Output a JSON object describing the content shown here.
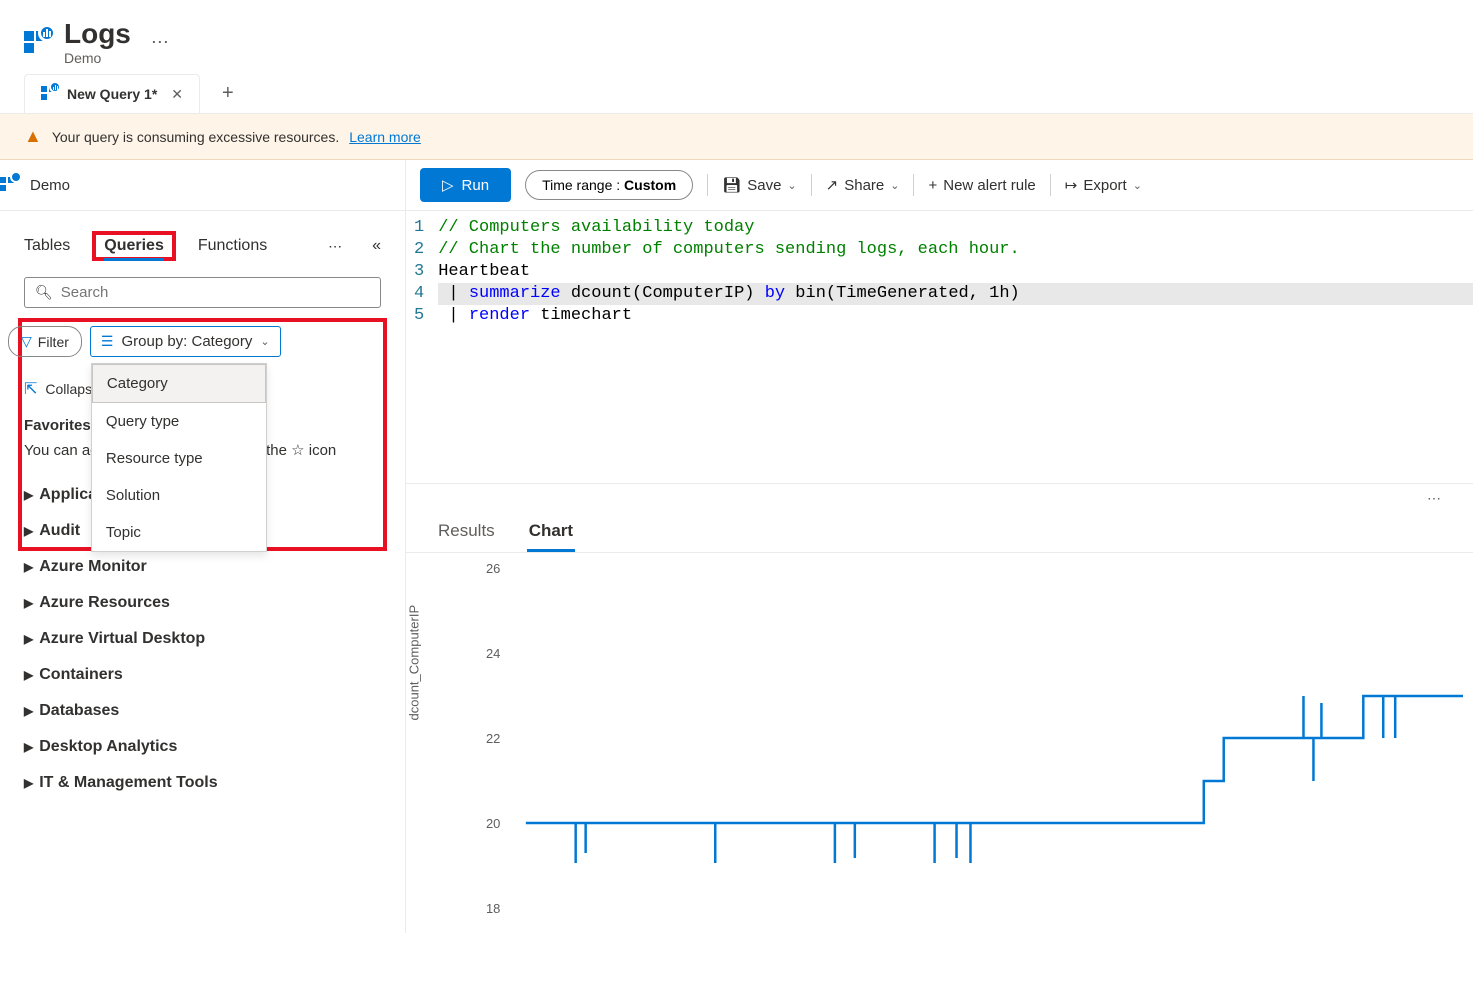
{
  "header": {
    "title": "Logs",
    "subtitle": "Demo"
  },
  "queryTab": {
    "label": "New Query 1*"
  },
  "warning": {
    "text": "Your query is consuming excessive resources.",
    "link": "Learn more"
  },
  "scope": {
    "label": "Demo"
  },
  "toolbar": {
    "run": "Run",
    "timeRangeLabel": "Time range :",
    "timeRangeValue": "Custom",
    "save": "Save",
    "share": "Share",
    "newAlert": "New alert rule",
    "export": "Export"
  },
  "panelTabs": {
    "tables": "Tables",
    "queries": "Queries",
    "functions": "Functions"
  },
  "search": {
    "placeholder": "Search"
  },
  "filter": {
    "label": "Filter"
  },
  "groupBy": {
    "label": "Group by: Category",
    "options": [
      "Category",
      "Query type",
      "Resource type",
      "Solution",
      "Topic"
    ]
  },
  "collapseAll": "Collapse all",
  "favorites": {
    "header": "Favorites",
    "textBefore": "You can add favorites by clicking on the",
    "textAfter": "icon"
  },
  "categories": [
    "Applications",
    "Audit",
    "Azure Monitor",
    "Azure Resources",
    "Azure Virtual Desktop",
    "Containers",
    "Databases",
    "Desktop Analytics",
    "IT & Management Tools"
  ],
  "code": {
    "l1": "// Computers availability today",
    "l2": "// Chart the number of computers sending logs, each hour.",
    "l3": "Heartbeat",
    "l4a": " | ",
    "l4b": "summarize",
    "l4c": " dcount(ComputerIP) ",
    "l4d": "by",
    "l4e": " bin(TimeGenerated, 1h)",
    "l5a": " | ",
    "l5b": "render",
    "l5c": " timechart"
  },
  "resultTabs": {
    "results": "Results",
    "chart": "Chart"
  },
  "chart_data": {
    "type": "line",
    "ylabel": "dcount_ComputerIP",
    "ylim": [
      18,
      26
    ],
    "yticks": [
      18,
      20,
      22,
      24,
      26
    ],
    "series": [
      {
        "name": "dcount_ComputerIP",
        "values": [
          20,
          20,
          20,
          20,
          20,
          20,
          20,
          20,
          20,
          20,
          20,
          20,
          20,
          20,
          20,
          20,
          20,
          20,
          20,
          20,
          20,
          20,
          20,
          20,
          20,
          20,
          20,
          20,
          20,
          21,
          22,
          22,
          22,
          22,
          22,
          22,
          22,
          23,
          23,
          23,
          23,
          23
        ]
      }
    ],
    "spikes_down": [
      2,
      3,
      9,
      14,
      15,
      19,
      20,
      21
    ],
    "spikes_up_at_22": [
      32,
      33
    ],
    "spikes_down_at_22": [
      33
    ],
    "spikes_22_to_23": [
      38
    ],
    "spikes_23_down": [
      39
    ]
  }
}
